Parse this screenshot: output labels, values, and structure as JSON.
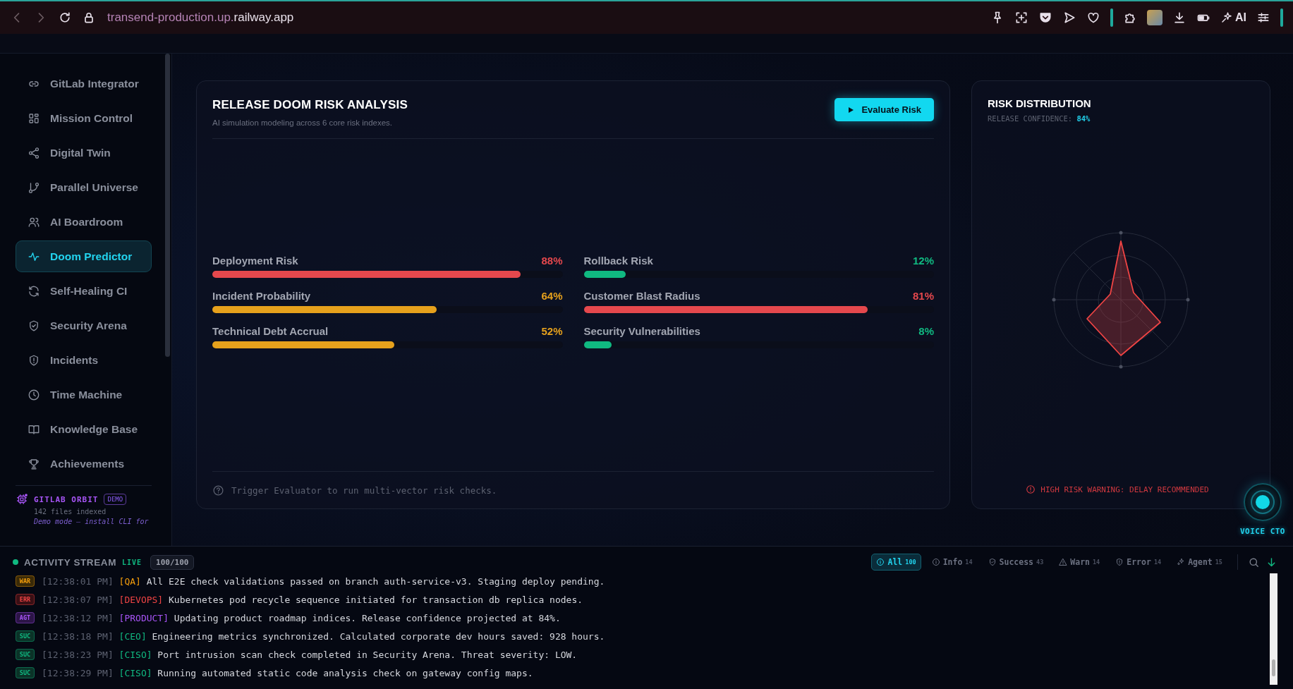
{
  "browser": {
    "url_host": "transend-production.up.",
    "url_domain": "railway.app",
    "ai_label": "AI"
  },
  "sidebar": {
    "items": [
      {
        "label": "GitLab Integrator",
        "selected": false
      },
      {
        "label": "Mission Control",
        "selected": false
      },
      {
        "label": "Digital Twin",
        "selected": false
      },
      {
        "label": "Parallel Universe",
        "selected": false
      },
      {
        "label": "AI Boardroom",
        "selected": false
      },
      {
        "label": "Doom Predictor",
        "selected": true
      },
      {
        "label": "Self-Healing CI",
        "selected": false
      },
      {
        "label": "Security Arena",
        "selected": false
      },
      {
        "label": "Incidents",
        "selected": false
      },
      {
        "label": "Time Machine",
        "selected": false
      },
      {
        "label": "Knowledge Base",
        "selected": false
      },
      {
        "label": "Achievements",
        "selected": false
      }
    ],
    "orbit": {
      "title": "GITLAB ORBIT",
      "badge": "DEMO",
      "status": "142 files indexed",
      "note": "Demo mode — install CLI for"
    }
  },
  "analysis": {
    "title": "RELEASE DOOM RISK ANALYSIS",
    "subtitle": "AI simulation modeling across 6 core risk indexes.",
    "button": "Evaluate Risk",
    "risks": [
      {
        "label": "Deployment Risk",
        "value": "88%",
        "level": 0.88,
        "color": "#e5484d"
      },
      {
        "label": "Rollback Risk",
        "value": "12%",
        "level": 0.12,
        "color": "#10b981"
      },
      {
        "label": "Incident Probability",
        "value": "64%",
        "level": 0.64,
        "color": "#e6a11c"
      },
      {
        "label": "Customer Blast Radius",
        "value": "81%",
        "level": 0.81,
        "color": "#e5484d"
      },
      {
        "label": "Technical Debt Accrual",
        "value": "52%",
        "level": 0.52,
        "color": "#e6a11c"
      },
      {
        "label": "Security Vulnerabilities",
        "value": "8%",
        "level": 0.08,
        "color": "#10b981"
      }
    ],
    "hint": "Trigger Evaluator to run multi-vector risk checks."
  },
  "distribution": {
    "title": "RISK DISTRIBUTION",
    "confidence_label": "RELEASE CONFIDENCE:",
    "confidence_value": "84%",
    "warning": "HIGH RISK WARNING: DELAY RECOMMENDED"
  },
  "voice": {
    "label": "VOICE CTO"
  },
  "activity": {
    "title": "ACTIVITY STREAM",
    "live": "LIVE",
    "count": "100/100",
    "filters": [
      {
        "label": "All",
        "count": "100",
        "selected": true
      },
      {
        "label": "Info",
        "count": "14",
        "selected": false
      },
      {
        "label": "Success",
        "count": "43",
        "selected": false
      },
      {
        "label": "Warn",
        "count": "14",
        "selected": false
      },
      {
        "label": "Error",
        "count": "14",
        "selected": false
      },
      {
        "label": "Agent",
        "count": "15",
        "selected": false
      }
    ],
    "entries": [
      {
        "kind": "warn",
        "tag": "WAR",
        "time": "[12:38:01 PM]",
        "source": "[QA]",
        "message": "All E2E check validations passed on branch auth-service-v3. Staging deploy pending."
      },
      {
        "kind": "error",
        "tag": "ERR",
        "time": "[12:38:07 PM]",
        "source": "[DEVOPS]",
        "message": "Kubernetes pod recycle sequence initiated for transaction db replica nodes."
      },
      {
        "kind": "agent",
        "tag": "AGT",
        "time": "[12:38:12 PM]",
        "source": "[PRODUCT]",
        "message": "Updating product roadmap indices. Release confidence projected at 84%."
      },
      {
        "kind": "success",
        "tag": "SUC",
        "time": "[12:38:18 PM]",
        "source": "[CEO]",
        "message": "Engineering metrics synchronized. Calculated corporate dev hours saved: 928 hours."
      },
      {
        "kind": "success",
        "tag": "SUC",
        "time": "[12:38:23 PM]",
        "source": "[CISO]",
        "message": "Port intrusion scan check completed in Security Arena. Threat severity: LOW."
      },
      {
        "kind": "success",
        "tag": "SUC",
        "time": "[12:38:29 PM]",
        "source": "[CISO]",
        "message": "Running automated static code analysis check on gateway config maps."
      }
    ]
  }
}
